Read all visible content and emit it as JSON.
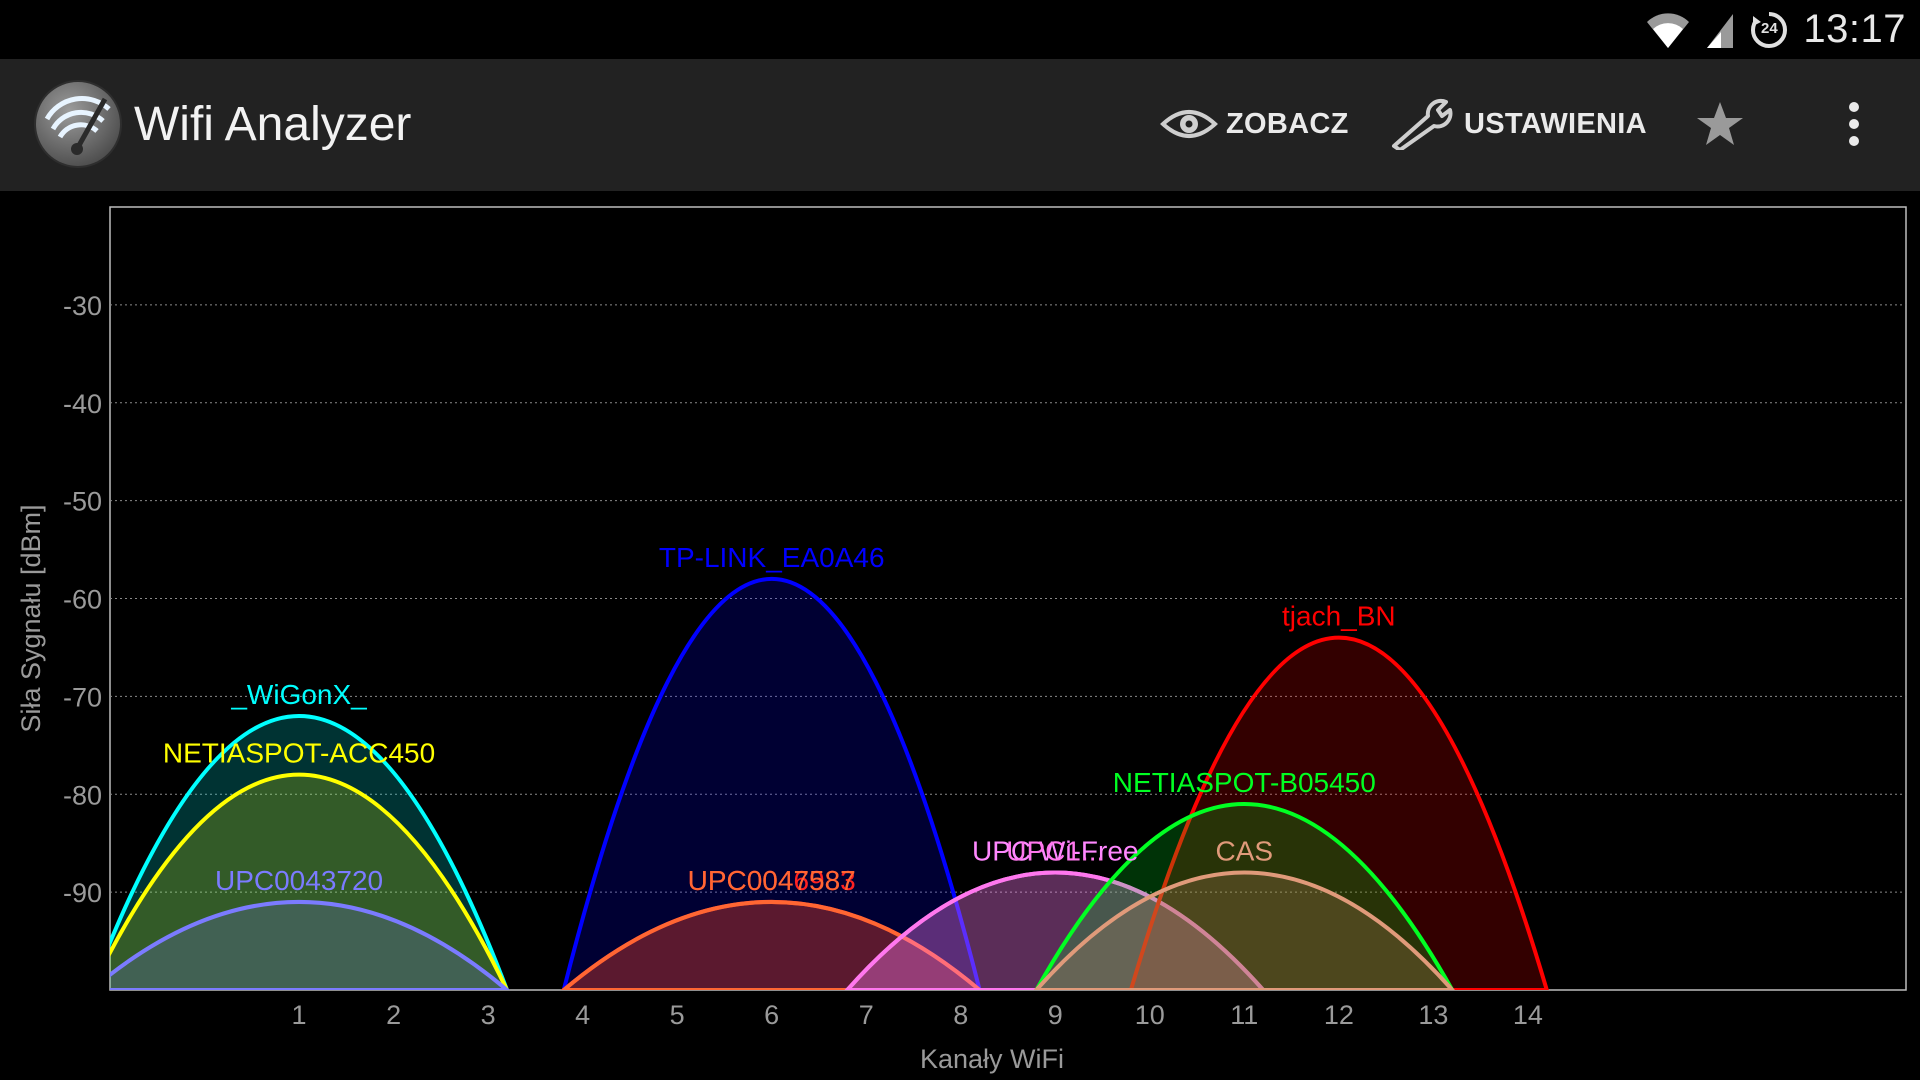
{
  "status_bar": {
    "time": "13:17",
    "wifi_icon": "wifi-signal-icon",
    "cell_icon": "cell-signal-icon",
    "alarm_icon": "clock-24-icon",
    "clock_badge": "24"
  },
  "app_bar": {
    "title": "Wifi Analyzer",
    "icon": "wifi-analyzer-logo-icon",
    "actions": {
      "see": {
        "label": "ZOBACZ",
        "icon": "eye-icon"
      },
      "settings": {
        "label": "USTAWIENIA",
        "icon": "wrench-icon"
      },
      "favorite": {
        "icon": "star-icon"
      },
      "overflow": {
        "icon": "overflow-menu-icon"
      }
    },
    "colors": {
      "background": "#222222",
      "text": "#eaeaea"
    }
  },
  "chart_data": {
    "type": "area",
    "xlabel": "Kanały WiFi",
    "ylabel": "Siła Sygnału [dBm]",
    "y_ticks": [
      -30,
      -40,
      -50,
      -60,
      -70,
      -80,
      -90
    ],
    "ylim": [
      -100,
      -20
    ],
    "x_ticks": [
      1,
      2,
      3,
      4,
      5,
      6,
      7,
      8,
      9,
      10,
      11,
      12,
      13,
      14
    ],
    "xlim": [
      -1,
      18
    ],
    "grid": "horizontal-dotted",
    "series": [
      {
        "name": "_WiGonX_",
        "channel": 1,
        "signal_dbm": -72,
        "color": "#00ffff"
      },
      {
        "name": "NETIASPOT-ACC450",
        "channel": 1,
        "signal_dbm": -78,
        "color": "#ffff00"
      },
      {
        "name": "UPC0043720",
        "channel": 1,
        "signal_dbm": -91,
        "color": "#7b7bff"
      },
      {
        "name": "TP-LINK_EA0A46",
        "channel": 6,
        "signal_dbm": -58,
        "color": "#0000ff"
      },
      {
        "name": "UPC0046983",
        "channel": 6,
        "signal_dbm": -91,
        "color": "#ff2222"
      },
      {
        "name": "UPC0047587",
        "channel": 6,
        "signal_dbm": -91,
        "color": "#ff6633"
      },
      {
        "name": "UPC Wi-Free",
        "channel": 9,
        "signal_dbm": -88,
        "color": "#ff88ff"
      },
      {
        "name": "UPC1...",
        "channel": 9,
        "signal_dbm": -88,
        "color": "#ff77ee"
      },
      {
        "name": "tjach_BN",
        "channel": 12,
        "signal_dbm": -64,
        "color": "#ff0000"
      },
      {
        "name": "NETIASPOT-B05450",
        "channel": 11,
        "signal_dbm": -81,
        "color": "#00ff22"
      },
      {
        "name": "CAS",
        "channel": 11,
        "signal_dbm": -88,
        "color": "#e09a7a"
      }
    ]
  }
}
